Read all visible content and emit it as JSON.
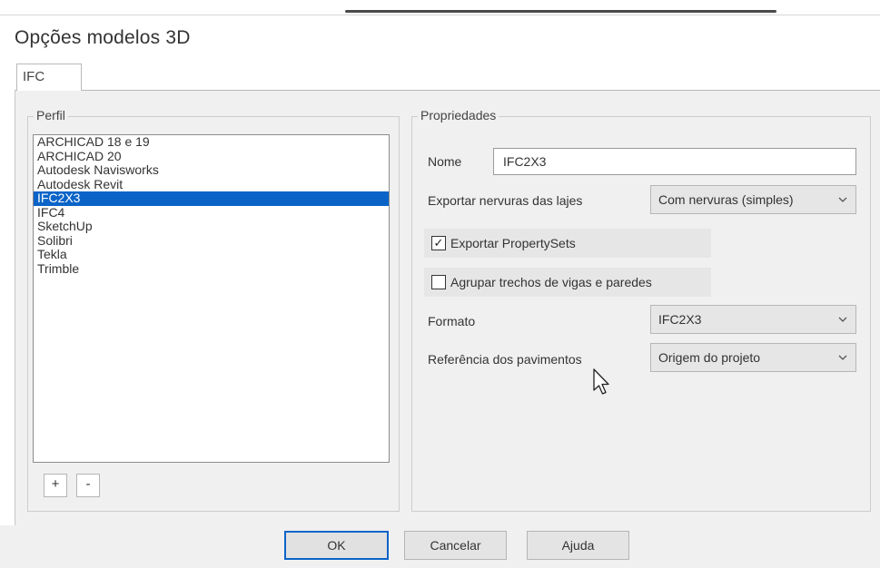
{
  "window": {
    "title": "Opções modelos 3D"
  },
  "tabs": [
    {
      "label": "IFC",
      "active": true
    }
  ],
  "profile": {
    "group_label": "Perfil",
    "items": [
      "ARCHICAD 18 e 19",
      "ARCHICAD 20",
      "Autodesk Navisworks",
      "Autodesk Revit",
      "IFC2X3",
      "IFC4",
      "SketchUp",
      "Solibri",
      "Tekla",
      "Trimble"
    ],
    "selected_item": "IFC2X3",
    "add_label": "+",
    "remove_label": "-"
  },
  "properties": {
    "group_label": "Propriedades",
    "name_label": "Nome",
    "name_value": "IFC2X3",
    "ribs_label": "Exportar nervuras das lajes",
    "ribs_value": "Com nervuras (simples)",
    "export_psets_label": "Exportar PropertySets",
    "export_psets_checked": true,
    "group_segments_label": "Agrupar trechos de vigas e paredes",
    "group_segments_checked": false,
    "format_label": "Formato",
    "format_value": "IFC2X3",
    "floor_ref_label": "Referência dos pavimentos",
    "floor_ref_value": "Origem do projeto"
  },
  "buttons": {
    "ok": "OK",
    "cancel": "Cancelar",
    "help": "Ajuda"
  },
  "icons": {
    "checked": "✓",
    "dropdown": "chevron-down-icon",
    "cursor": "mouse-pointer-icon"
  },
  "colors": {
    "selection": "#0a64c8",
    "panel": "#f0f0f0"
  }
}
